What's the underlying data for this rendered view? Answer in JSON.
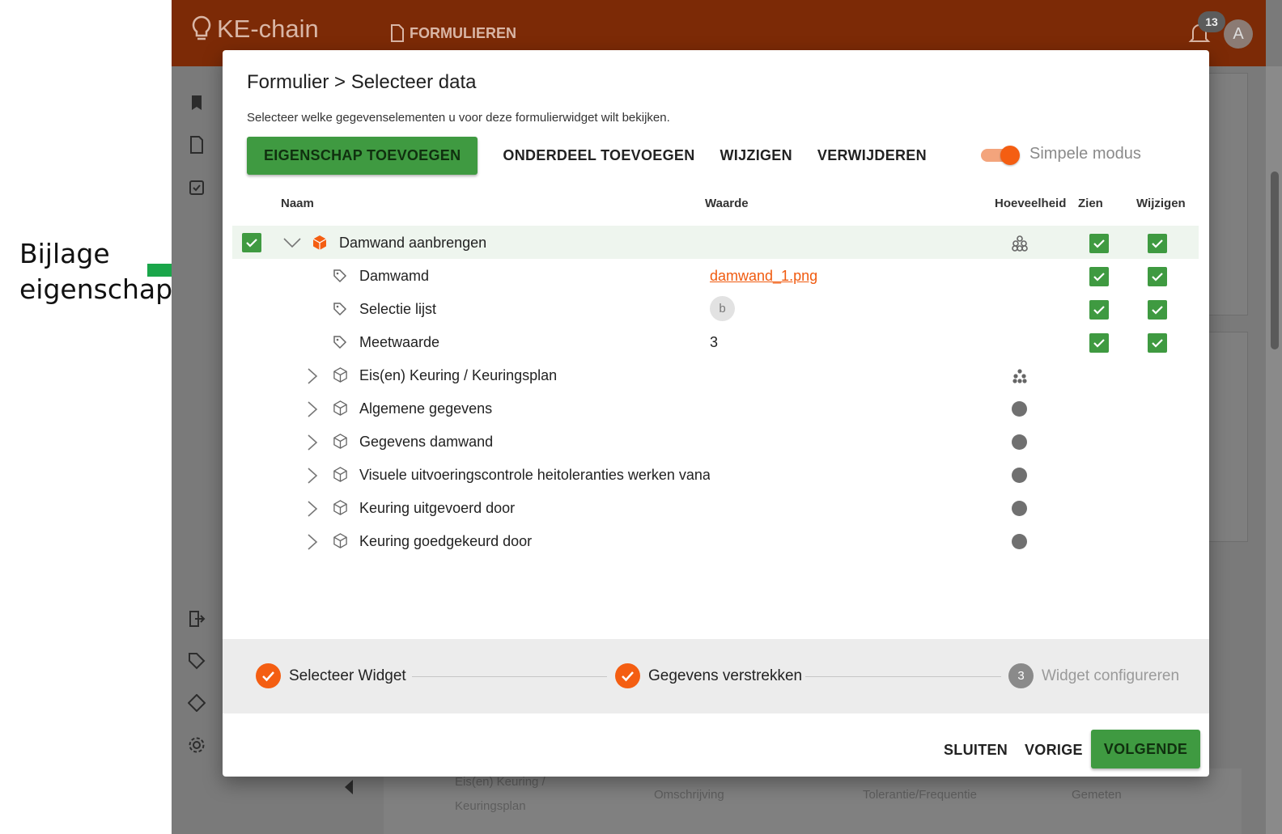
{
  "annotation": {
    "line1": "Bijlage",
    "line2": "eigenschap",
    "arrow_color": "#1aa64a"
  },
  "app": {
    "brand": "KE-chain",
    "nav_item": "FORMULIEREN",
    "notification_count": "13",
    "avatar_initial": "A",
    "background_texts": [
      "Eis(en) Keuring /",
      "Keuringsplan",
      "Omschrijving",
      "Tolerantie/Frequentie",
      "Gemeten"
    ]
  },
  "dialog": {
    "title": "Formulier > Selecteer data",
    "subtitle": "Selecteer welke gegevenselementen u voor deze formulierwidget wilt bekijken.",
    "toolbar": {
      "add_property": "EIGENSCHAP TOEVOEGEN",
      "add_part": "ONDERDEEL TOEVOEGEN",
      "edit": "WIJZIGEN",
      "delete": "VERWIJDEREN"
    },
    "simple_mode": {
      "label": "Simpele modus",
      "enabled": true
    },
    "columns": {
      "name": "Naam",
      "value": "Waarde",
      "quantity": "Hoeveelheid",
      "view": "Zien",
      "edit": "Wijzigen"
    },
    "rows": [
      {
        "name": "Damwand aanbrengen",
        "type": "part",
        "expanded": true,
        "selected": true,
        "quantity_icon": "multi-instance-icon",
        "view": true,
        "edit": true
      },
      {
        "name": "Damwamd",
        "type": "property",
        "value": "damwand_1.png",
        "view": true,
        "edit": true
      },
      {
        "name": "Selectie lijst",
        "type": "property",
        "value": "b",
        "view": true,
        "edit": true
      },
      {
        "name": "Meetwaarde",
        "type": "property",
        "value": "3",
        "view": true,
        "edit": true
      },
      {
        "name": "Eis(en) Keuring / Keuringsplan",
        "type": "part",
        "quantity_icon": "multi-instance-icon"
      },
      {
        "name": "Algemene gegevens",
        "type": "part",
        "quantity_icon": "single-instance-icon"
      },
      {
        "name": "Gegevens damwand",
        "type": "part",
        "quantity_icon": "single-instance-icon"
      },
      {
        "name": "Visuele uitvoeringscontrole heitoleranties werken vana",
        "type": "part",
        "quantity_icon": "single-instance-icon"
      },
      {
        "name": "Keuring uitgevoerd door",
        "type": "part",
        "quantity_icon": "single-instance-icon"
      },
      {
        "name": "Keuring goedgekeurd door",
        "type": "part",
        "quantity_icon": "single-instance-icon"
      }
    ],
    "steps": [
      {
        "label": "Selecteer Widget",
        "status": "done"
      },
      {
        "label": "Gegevens verstrekken",
        "status": "done"
      },
      {
        "number": "3",
        "label": "Widget configureren",
        "status": "pending"
      }
    ],
    "footer": {
      "close": "SLUITEN",
      "previous": "VORIGE",
      "next": "VOLGENDE"
    },
    "colors": {
      "primary_green": "#3f9a41",
      "accent_orange": "#f45e12",
      "topbar": "#7c2a06"
    }
  }
}
